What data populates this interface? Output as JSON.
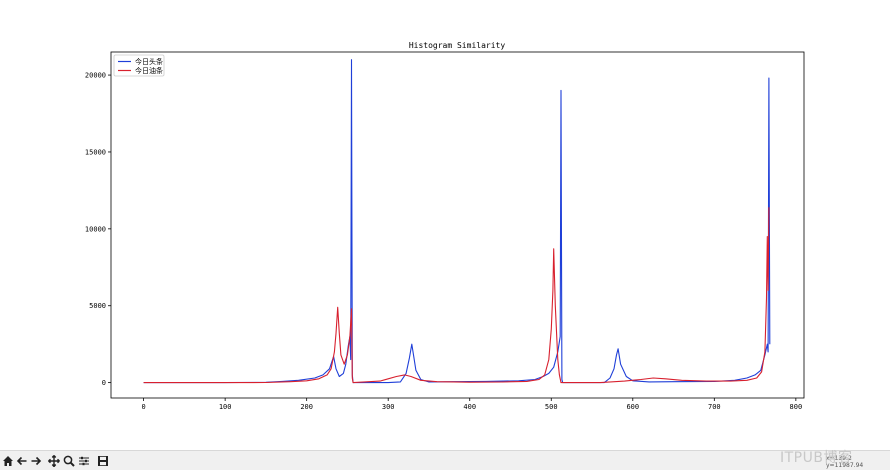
{
  "toolbar": {
    "buttons": [
      {
        "icon": "home-icon"
      },
      {
        "icon": "back-arrow-icon"
      },
      {
        "icon": "forward-arrow-icon"
      },
      {
        "icon": "pan-icon"
      },
      {
        "icon": "zoom-icon"
      },
      {
        "icon": "configure-subplots-icon"
      },
      {
        "icon": "save-icon"
      }
    ],
    "coordinate_readout": "x=139.2 y=11987.94",
    "watermark": "ITPUB博客"
  },
  "chart_data": {
    "type": "line",
    "title": "Histogram Similarity",
    "xlabel": "",
    "ylabel": "",
    "xlim": [
      -40,
      810
    ],
    "ylim": [
      -1000,
      21500
    ],
    "xticks": [
      0,
      100,
      200,
      300,
      400,
      500,
      600,
      700,
      800
    ],
    "yticks": [
      0,
      5000,
      10000,
      15000,
      20000
    ],
    "legend_position": "top-left",
    "grid": false,
    "series": [
      {
        "name": "今日头条",
        "color": "#1f3fd8",
        "points": [
          [
            0,
            0
          ],
          [
            100,
            0
          ],
          [
            150,
            20
          ],
          [
            170,
            80
          ],
          [
            190,
            150
          ],
          [
            210,
            300
          ],
          [
            220,
            500
          ],
          [
            228,
            900
          ],
          [
            233,
            1700
          ],
          [
            236,
            900
          ],
          [
            240,
            400
          ],
          [
            245,
            600
          ],
          [
            248,
            1200
          ],
          [
            251,
            2400
          ],
          [
            253,
            3000
          ],
          [
            254,
            1500
          ],
          [
            255,
            21000
          ],
          [
            256,
            500
          ],
          [
            257,
            0
          ],
          [
            300,
            0
          ],
          [
            315,
            50
          ],
          [
            322,
            600
          ],
          [
            326,
            1600
          ],
          [
            329,
            2500
          ],
          [
            331,
            1800
          ],
          [
            334,
            800
          ],
          [
            340,
            200
          ],
          [
            350,
            40
          ],
          [
            380,
            60
          ],
          [
            420,
            80
          ],
          [
            460,
            120
          ],
          [
            480,
            200
          ],
          [
            490,
            400
          ],
          [
            497,
            600
          ],
          [
            503,
            1000
          ],
          [
            508,
            2000
          ],
          [
            511,
            3000
          ],
          [
            512,
            19000
          ],
          [
            513,
            200
          ],
          [
            514,
            0
          ],
          [
            565,
            0
          ],
          [
            572,
            300
          ],
          [
            577,
            900
          ],
          [
            580,
            1800
          ],
          [
            582,
            2200
          ],
          [
            585,
            1200
          ],
          [
            592,
            400
          ],
          [
            600,
            120
          ],
          [
            620,
            50
          ],
          [
            650,
            60
          ],
          [
            700,
            80
          ],
          [
            725,
            150
          ],
          [
            740,
            300
          ],
          [
            750,
            500
          ],
          [
            757,
            800
          ],
          [
            762,
            1800
          ],
          [
            765,
            2500
          ],
          [
            766,
            2000
          ],
          [
            767,
            19800
          ],
          [
            768,
            2500
          ]
        ]
      },
      {
        "name": "今日油条",
        "color": "#d8202e",
        "points": [
          [
            0,
            0
          ],
          [
            100,
            0
          ],
          [
            150,
            10
          ],
          [
            180,
            60
          ],
          [
            200,
            120
          ],
          [
            215,
            250
          ],
          [
            225,
            500
          ],
          [
            230,
            900
          ],
          [
            234,
            2000
          ],
          [
            236,
            3200
          ],
          [
            238,
            4900
          ],
          [
            240,
            3200
          ],
          [
            242,
            1800
          ],
          [
            246,
            1200
          ],
          [
            250,
            1800
          ],
          [
            253,
            3000
          ],
          [
            255,
            4800
          ],
          [
            256,
            300
          ],
          [
            257,
            0
          ],
          [
            290,
            100
          ],
          [
            300,
            250
          ],
          [
            310,
            400
          ],
          [
            320,
            500
          ],
          [
            328,
            400
          ],
          [
            340,
            150
          ],
          [
            360,
            60
          ],
          [
            400,
            30
          ],
          [
            440,
            40
          ],
          [
            470,
            80
          ],
          [
            485,
            200
          ],
          [
            492,
            500
          ],
          [
            497,
            1500
          ],
          [
            500,
            3500
          ],
          [
            502,
            6000
          ],
          [
            503,
            8700
          ],
          [
            505,
            5000
          ],
          [
            508,
            1500
          ],
          [
            510,
            500
          ],
          [
            512,
            0
          ],
          [
            560,
            0
          ],
          [
            590,
            100
          ],
          [
            610,
            200
          ],
          [
            625,
            300
          ],
          [
            640,
            250
          ],
          [
            660,
            150
          ],
          [
            690,
            100
          ],
          [
            720,
            100
          ],
          [
            740,
            150
          ],
          [
            752,
            300
          ],
          [
            758,
            700
          ],
          [
            762,
            2000
          ],
          [
            764,
            5500
          ],
          [
            765,
            9500
          ],
          [
            766,
            6000
          ],
          [
            767,
            11400
          ]
        ]
      }
    ]
  }
}
